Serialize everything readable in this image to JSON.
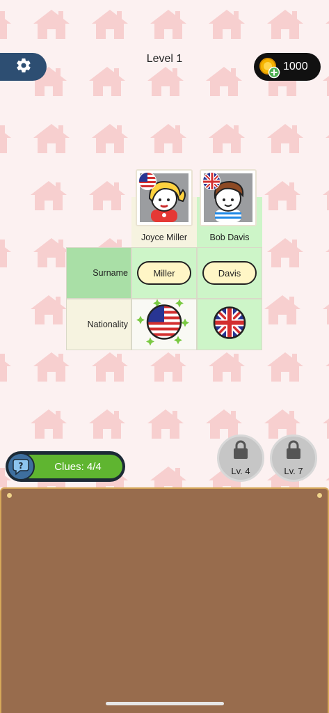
{
  "header": {
    "level_title": "Level 1",
    "coins": "1000"
  },
  "grid": {
    "people": [
      {
        "name": "Joyce Miller",
        "flag": "usa-flag"
      },
      {
        "name": "Bob Davis",
        "flag": "uk-flag"
      }
    ],
    "rows": [
      {
        "label": "Surname",
        "values": [
          "Miller",
          "Davis"
        ]
      },
      {
        "label": "Nationality",
        "values": [
          "usa-flag",
          "uk-flag"
        ]
      }
    ]
  },
  "clues": {
    "label": "Clues: 4/4"
  },
  "locks": [
    {
      "label": "Lv. 4"
    },
    {
      "label": "Lv. 7"
    }
  ],
  "colors": {
    "background": "#fcf1f1",
    "house_pattern": "#f7cfcf",
    "settings": "#2d4e72",
    "cell_green": "#cdf5c8",
    "row_label_green": "#a9dfa6",
    "cell_cream": "#f6f3e0",
    "clues_green": "#5fb530",
    "board": "#986c4d"
  }
}
